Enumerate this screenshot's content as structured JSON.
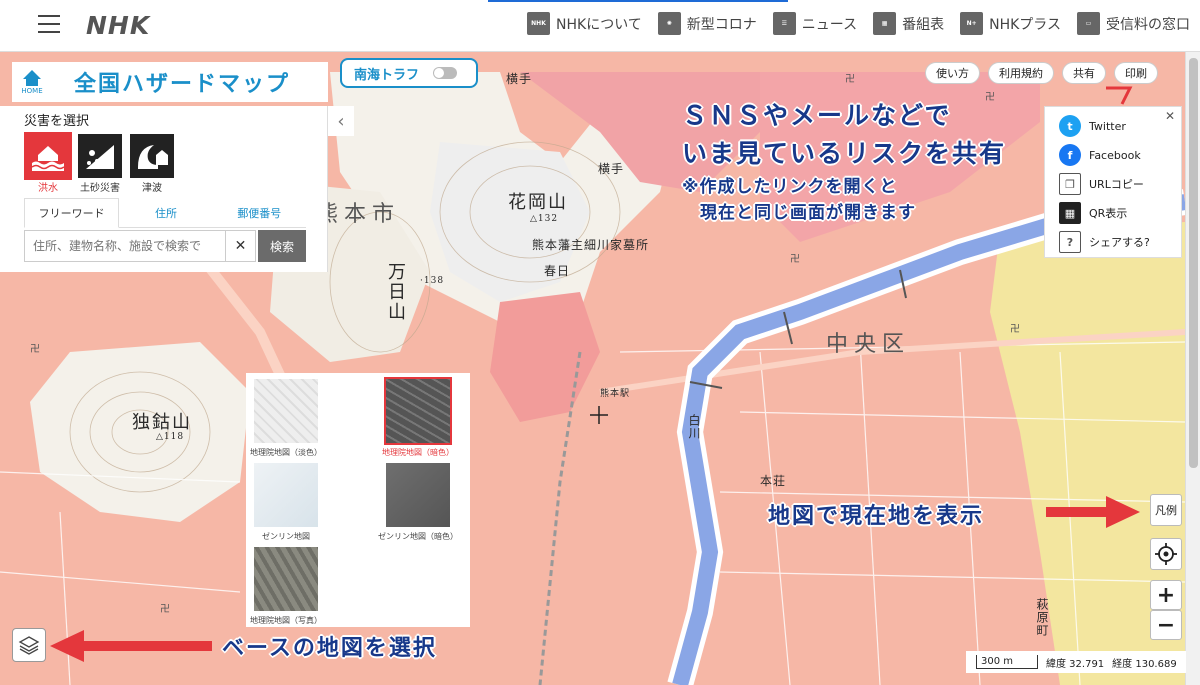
{
  "header": {
    "logo": "NHK",
    "nav": [
      {
        "label": "NHKについて",
        "icon": "nhk-badge-icon"
      },
      {
        "label": "新型コロナ",
        "icon": "virus-icon"
      },
      {
        "label": "ニュース",
        "icon": "news-icon"
      },
      {
        "label": "番組表",
        "icon": "program-grid-icon"
      },
      {
        "label": "NHKプラス",
        "icon": "nhk-plus-icon"
      },
      {
        "label": "受信料の窓口",
        "icon": "tv-icon"
      }
    ]
  },
  "title": {
    "home_label": "HOME",
    "site_title": "全国ハザードマップ"
  },
  "disaster_panel": {
    "heading": "災害を選択",
    "hazards": [
      {
        "label": "洪水",
        "active": true,
        "icon": "flood-icon"
      },
      {
        "label": "土砂災害",
        "active": false,
        "icon": "landslide-icon"
      },
      {
        "label": "津波",
        "active": false,
        "icon": "tsunami-icon"
      }
    ],
    "tabs": [
      "フリーワード",
      "住所",
      "郵便番号"
    ],
    "search": {
      "placeholder": "住所、建物名称、施設で検索で",
      "clear": "✕",
      "button": "検索"
    }
  },
  "nankai": {
    "label": "南海トラフ"
  },
  "top_buttons": [
    "使い方",
    "利用規約",
    "共有",
    "印刷"
  ],
  "share": {
    "close": "✕",
    "items": [
      "Twitter",
      "Facebook",
      "URLコピー",
      "QR表示",
      "シェアする?"
    ]
  },
  "annotations": {
    "share_line1": "ＳＮＳやメールなどで",
    "share_line2": "いま見ているリスクを共有",
    "share_note1": "※作成したリンクを開くと",
    "share_note2": "現在と同じ画面が開きます",
    "location": "地図で現在地を表示",
    "basemap": "ベースの地図を選択"
  },
  "basemaps": [
    {
      "label": "地理院地図（淡色）",
      "selected": false
    },
    {
      "label": "地理院地図（暗色）",
      "selected": true
    },
    {
      "label": "ゼンリン地図",
      "selected": false
    },
    {
      "label": "ゼンリン地図（暗色）",
      "selected": false
    },
    {
      "label": "地理院地図（写真）",
      "selected": false
    }
  ],
  "places": {
    "kumamoto": "熊本市",
    "hanaokayama": "花岡山",
    "mannichiyama": "万日山",
    "dokusekisan": "独鈷山",
    "chuoku": "中央区",
    "yokote": "横手",
    "kasuga": "春日",
    "hosokawa": "熊本藩主細川家墓所",
    "hagiwara": "萩原町",
    "shirakawa": "白川",
    "honjo": "本荘",
    "kumamoto_st": "熊本駅",
    "elev_138": "·138",
    "elev_132": "△132",
    "elev_118": "△118"
  },
  "controls": {
    "legend": "凡例",
    "zoom_in": "+",
    "zoom_out": "−"
  },
  "scale": {
    "distance": "300 m",
    "lat": "緯度 32.791",
    "lon": "経度 130.689"
  },
  "colors": {
    "accent": "#1a8fc9",
    "danger": "#e4373c",
    "annotation": "#17388a",
    "flood_pink": "#f6b7a6",
    "river": "#8aa6e6"
  }
}
